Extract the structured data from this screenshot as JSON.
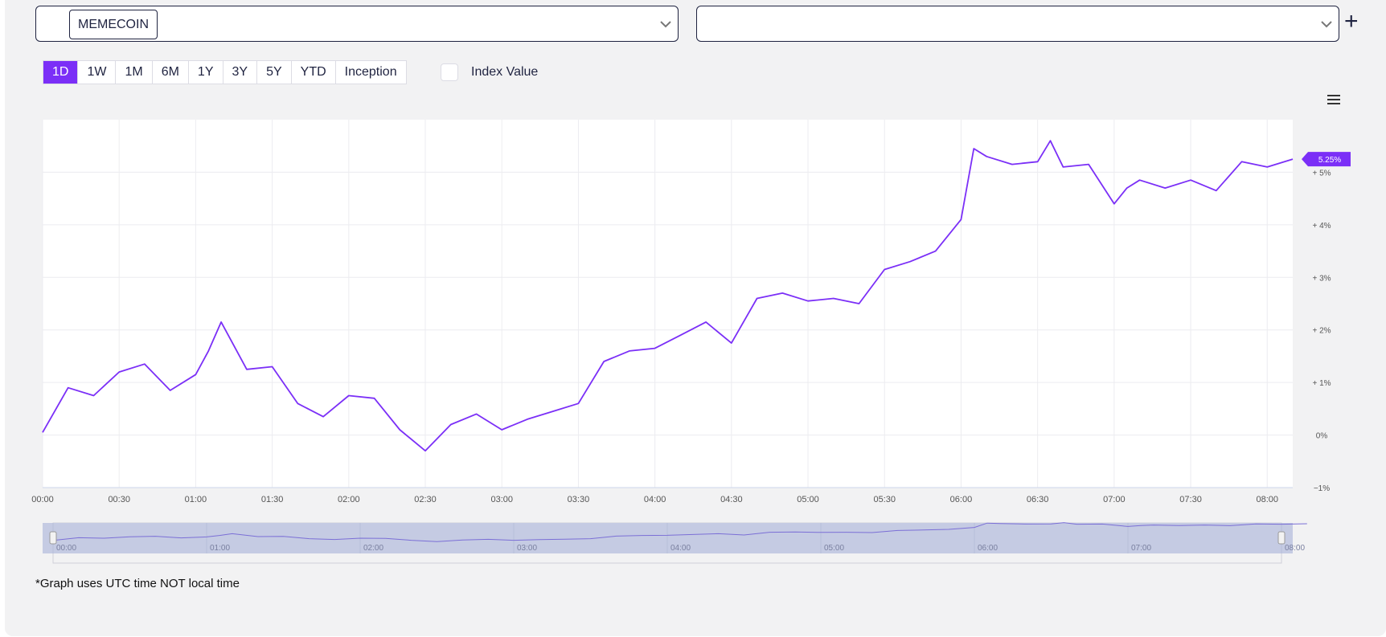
{
  "selectors": {
    "primary": {
      "chip": "MEMECOIN"
    },
    "secondary": {
      "chip": ""
    }
  },
  "range_buttons": [
    {
      "label": "1D",
      "active": true
    },
    {
      "label": "1W",
      "active": false
    },
    {
      "label": "1M",
      "active": false
    },
    {
      "label": "6M",
      "active": false
    },
    {
      "label": "1Y",
      "active": false
    },
    {
      "label": "3Y",
      "active": false
    },
    {
      "label": "5Y",
      "active": false
    },
    {
      "label": "YTD",
      "active": false
    },
    {
      "label": "Inception",
      "active": false
    }
  ],
  "index_value_label": "Index Value",
  "footnote": "*Graph uses UTC time NOT local time",
  "colors": {
    "accent": "#7b2ff7",
    "navigator_fill": "#c5cbe3"
  },
  "icons": {
    "dropdown": "chevron-down-icon",
    "add": "plus-icon",
    "menu": "hamburger-menu-icon"
  },
  "chart_data": {
    "type": "line",
    "title": "",
    "xlabel": "",
    "ylabel": "",
    "ylim": [
      -1,
      6
    ],
    "yticks": [
      -1,
      0,
      1,
      2,
      3,
      4,
      5
    ],
    "ytick_labels": [
      "−1%",
      "0%",
      "+ 1%",
      "+ 2%",
      "+ 3%",
      "+ 4%",
      "+ 5%"
    ],
    "xlim": [
      "00:00",
      "08:10"
    ],
    "xtick_labels": [
      "00:00",
      "00:30",
      "01:00",
      "01:30",
      "02:00",
      "02:30",
      "03:00",
      "03:30",
      "04:00",
      "04:30",
      "05:00",
      "05:30",
      "06:00",
      "06:30",
      "07:00",
      "07:30",
      "08:00"
    ],
    "navigator_labels": [
      "00:00",
      "01:00",
      "02:00",
      "03:00",
      "04:00",
      "05:00",
      "06:00",
      "07:00",
      "08:00"
    ],
    "last_value_label": "5.25%",
    "grid": true,
    "series": [
      {
        "x": [
          "00:00",
          "00:10",
          "00:20",
          "00:30",
          "00:40",
          "00:50",
          "01:00",
          "01:05",
          "01:10",
          "01:20",
          "01:30",
          "01:40",
          "01:50",
          "02:00",
          "02:10",
          "02:20",
          "02:30",
          "02:40",
          "02:50",
          "03:00",
          "03:10",
          "03:20",
          "03:30",
          "03:40",
          "03:50",
          "04:00",
          "04:10",
          "04:20",
          "04:30",
          "04:40",
          "04:50",
          "05:00",
          "05:10",
          "05:20",
          "05:30",
          "05:40",
          "05:50",
          "06:00",
          "06:05",
          "06:10",
          "06:20",
          "06:30",
          "06:35",
          "06:40",
          "06:50",
          "07:00",
          "07:05",
          "07:10",
          "07:20",
          "07:30",
          "07:40",
          "07:50",
          "08:00",
          "08:10"
        ],
        "y": [
          0.05,
          0.9,
          0.75,
          1.2,
          1.35,
          0.85,
          1.15,
          1.6,
          2.15,
          1.25,
          1.3,
          0.6,
          0.35,
          0.75,
          0.7,
          0.1,
          -0.3,
          0.2,
          0.4,
          0.1,
          0.3,
          0.45,
          0.6,
          1.4,
          1.6,
          1.65,
          1.9,
          2.15,
          1.75,
          2.6,
          2.7,
          2.55,
          2.6,
          2.5,
          3.15,
          3.3,
          3.5,
          4.1,
          5.45,
          5.3,
          5.15,
          5.2,
          5.6,
          5.1,
          5.15,
          4.4,
          4.7,
          4.85,
          4.7,
          4.85,
          4.65,
          5.2,
          5.1,
          5.25
        ]
      }
    ]
  }
}
